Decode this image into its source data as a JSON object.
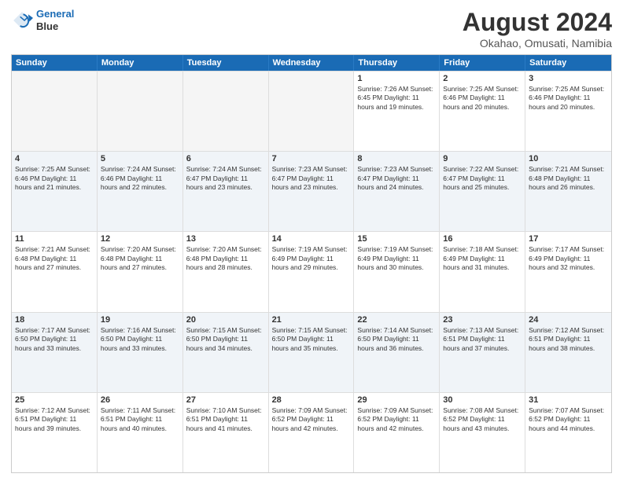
{
  "logo": {
    "line1": "General",
    "line2": "Blue"
  },
  "title": "August 2024",
  "subtitle": "Okahao, Omusati, Namibia",
  "days": [
    "Sunday",
    "Monday",
    "Tuesday",
    "Wednesday",
    "Thursday",
    "Friday",
    "Saturday"
  ],
  "weeks": [
    [
      {
        "day": "",
        "text": ""
      },
      {
        "day": "",
        "text": ""
      },
      {
        "day": "",
        "text": ""
      },
      {
        "day": "",
        "text": ""
      },
      {
        "day": "1",
        "text": "Sunrise: 7:26 AM\nSunset: 6:45 PM\nDaylight: 11 hours and 19 minutes."
      },
      {
        "day": "2",
        "text": "Sunrise: 7:25 AM\nSunset: 6:46 PM\nDaylight: 11 hours and 20 minutes."
      },
      {
        "day": "3",
        "text": "Sunrise: 7:25 AM\nSunset: 6:46 PM\nDaylight: 11 hours and 20 minutes."
      }
    ],
    [
      {
        "day": "4",
        "text": "Sunrise: 7:25 AM\nSunset: 6:46 PM\nDaylight: 11 hours and 21 minutes."
      },
      {
        "day": "5",
        "text": "Sunrise: 7:24 AM\nSunset: 6:46 PM\nDaylight: 11 hours and 22 minutes."
      },
      {
        "day": "6",
        "text": "Sunrise: 7:24 AM\nSunset: 6:47 PM\nDaylight: 11 hours and 23 minutes."
      },
      {
        "day": "7",
        "text": "Sunrise: 7:23 AM\nSunset: 6:47 PM\nDaylight: 11 hours and 23 minutes."
      },
      {
        "day": "8",
        "text": "Sunrise: 7:23 AM\nSunset: 6:47 PM\nDaylight: 11 hours and 24 minutes."
      },
      {
        "day": "9",
        "text": "Sunrise: 7:22 AM\nSunset: 6:47 PM\nDaylight: 11 hours and 25 minutes."
      },
      {
        "day": "10",
        "text": "Sunrise: 7:21 AM\nSunset: 6:48 PM\nDaylight: 11 hours and 26 minutes."
      }
    ],
    [
      {
        "day": "11",
        "text": "Sunrise: 7:21 AM\nSunset: 6:48 PM\nDaylight: 11 hours and 27 minutes."
      },
      {
        "day": "12",
        "text": "Sunrise: 7:20 AM\nSunset: 6:48 PM\nDaylight: 11 hours and 27 minutes."
      },
      {
        "day": "13",
        "text": "Sunrise: 7:20 AM\nSunset: 6:48 PM\nDaylight: 11 hours and 28 minutes."
      },
      {
        "day": "14",
        "text": "Sunrise: 7:19 AM\nSunset: 6:49 PM\nDaylight: 11 hours and 29 minutes."
      },
      {
        "day": "15",
        "text": "Sunrise: 7:19 AM\nSunset: 6:49 PM\nDaylight: 11 hours and 30 minutes."
      },
      {
        "day": "16",
        "text": "Sunrise: 7:18 AM\nSunset: 6:49 PM\nDaylight: 11 hours and 31 minutes."
      },
      {
        "day": "17",
        "text": "Sunrise: 7:17 AM\nSunset: 6:49 PM\nDaylight: 11 hours and 32 minutes."
      }
    ],
    [
      {
        "day": "18",
        "text": "Sunrise: 7:17 AM\nSunset: 6:50 PM\nDaylight: 11 hours and 33 minutes."
      },
      {
        "day": "19",
        "text": "Sunrise: 7:16 AM\nSunset: 6:50 PM\nDaylight: 11 hours and 33 minutes."
      },
      {
        "day": "20",
        "text": "Sunrise: 7:15 AM\nSunset: 6:50 PM\nDaylight: 11 hours and 34 minutes."
      },
      {
        "day": "21",
        "text": "Sunrise: 7:15 AM\nSunset: 6:50 PM\nDaylight: 11 hours and 35 minutes."
      },
      {
        "day": "22",
        "text": "Sunrise: 7:14 AM\nSunset: 6:50 PM\nDaylight: 11 hours and 36 minutes."
      },
      {
        "day": "23",
        "text": "Sunrise: 7:13 AM\nSunset: 6:51 PM\nDaylight: 11 hours and 37 minutes."
      },
      {
        "day": "24",
        "text": "Sunrise: 7:12 AM\nSunset: 6:51 PM\nDaylight: 11 hours and 38 minutes."
      }
    ],
    [
      {
        "day": "25",
        "text": "Sunrise: 7:12 AM\nSunset: 6:51 PM\nDaylight: 11 hours and 39 minutes."
      },
      {
        "day": "26",
        "text": "Sunrise: 7:11 AM\nSunset: 6:51 PM\nDaylight: 11 hours and 40 minutes."
      },
      {
        "day": "27",
        "text": "Sunrise: 7:10 AM\nSunset: 6:51 PM\nDaylight: 11 hours and 41 minutes."
      },
      {
        "day": "28",
        "text": "Sunrise: 7:09 AM\nSunset: 6:52 PM\nDaylight: 11 hours and 42 minutes."
      },
      {
        "day": "29",
        "text": "Sunrise: 7:09 AM\nSunset: 6:52 PM\nDaylight: 11 hours and 42 minutes."
      },
      {
        "day": "30",
        "text": "Sunrise: 7:08 AM\nSunset: 6:52 PM\nDaylight: 11 hours and 43 minutes."
      },
      {
        "day": "31",
        "text": "Sunrise: 7:07 AM\nSunset: 6:52 PM\nDaylight: 11 hours and 44 minutes."
      }
    ]
  ]
}
